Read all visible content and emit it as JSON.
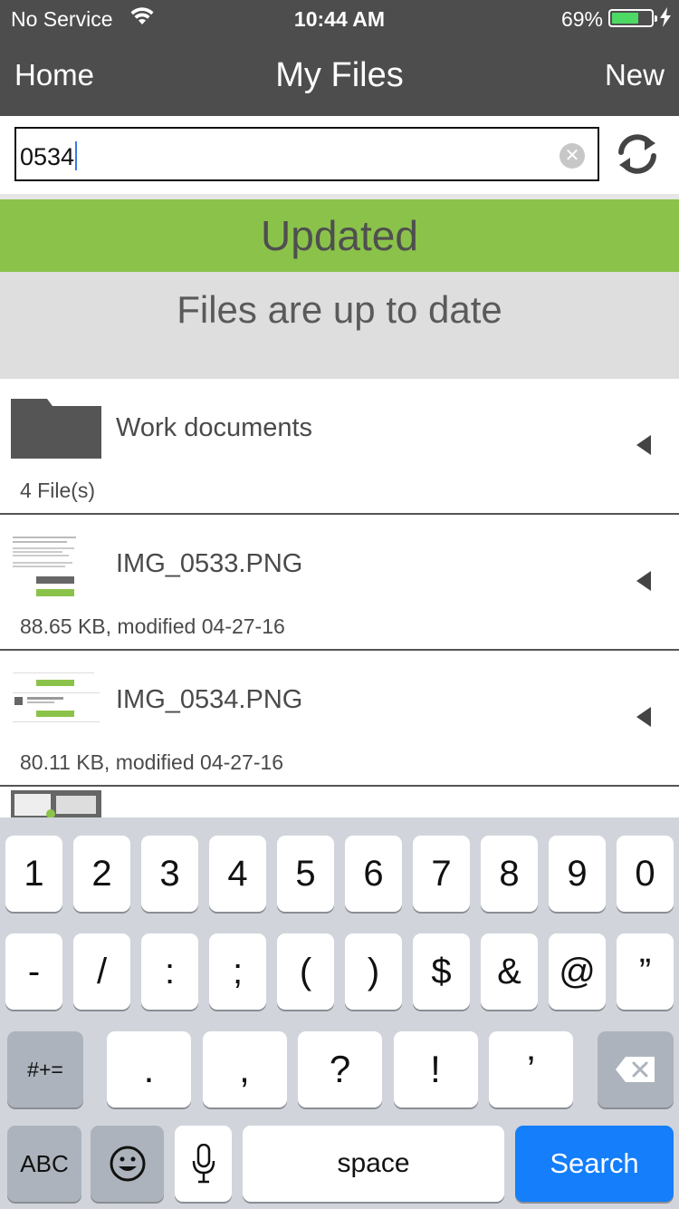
{
  "status_bar": {
    "carrier": "No Service",
    "time": "10:44 AM",
    "battery_pct": "69%",
    "battery_level": 0.69,
    "battery_color": "#4cd964"
  },
  "nav": {
    "left": "Home",
    "title": "My Files",
    "right": "New"
  },
  "search": {
    "value": "0534",
    "clear_glyph": "✕",
    "refresh_icon": "refresh-icon"
  },
  "banner": {
    "status": "Updated",
    "message": "Files are up to date",
    "status_color": "#8bc34a"
  },
  "files": [
    {
      "name": "Work documents",
      "meta": "4 File(s)",
      "kind": "folder"
    },
    {
      "name": "IMG_0533.PNG",
      "meta": "88.65 KB, modified 04-27-16",
      "kind": "image"
    },
    {
      "name": "IMG_0534.PNG",
      "meta": "80.11 KB, modified 04-27-16",
      "kind": "image"
    }
  ],
  "keyboard": {
    "row1": [
      "1",
      "2",
      "3",
      "4",
      "5",
      "6",
      "7",
      "8",
      "9",
      "0"
    ],
    "row2": [
      "-",
      "/",
      ":",
      ";",
      "(",
      ")",
      "$",
      "&",
      "@",
      "”"
    ],
    "row3_left": "#+=",
    "row3": [
      ".",
      ",",
      "?",
      "!",
      "’"
    ],
    "row4": {
      "abc": "ABC",
      "space": "space",
      "search": "Search"
    },
    "accent": "#147efb"
  }
}
